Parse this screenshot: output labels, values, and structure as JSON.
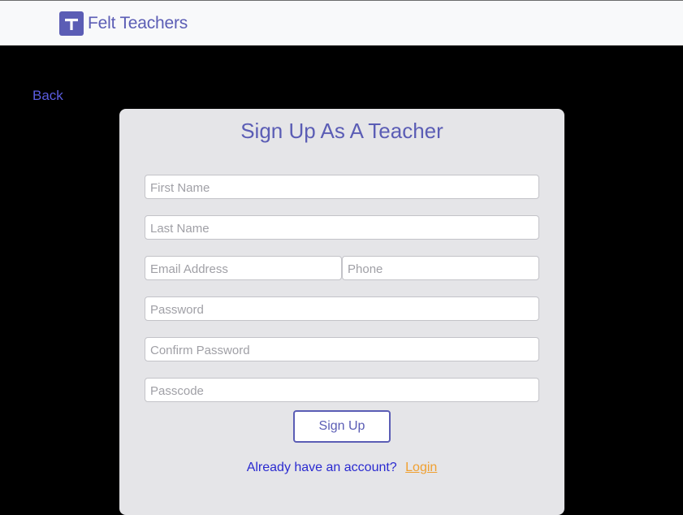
{
  "header": {
    "logo_letter": "T",
    "brand": "Felt Teachers",
    "colors": {
      "brand": "#5b5db5",
      "bar_bg": "#f8f9fa"
    }
  },
  "nav": {
    "back_label": "Back"
  },
  "form": {
    "title": "Sign Up As A Teacher",
    "fields": {
      "first_name": {
        "placeholder": "First Name",
        "value": ""
      },
      "last_name": {
        "placeholder": "Last Name",
        "value": ""
      },
      "email": {
        "placeholder": "Email Address",
        "value": ""
      },
      "phone": {
        "placeholder": "Phone",
        "value": ""
      },
      "password": {
        "placeholder": "Password",
        "value": ""
      },
      "confirm_password": {
        "placeholder": "Confirm Password",
        "value": ""
      },
      "passcode": {
        "placeholder": "Passcode",
        "value": ""
      }
    },
    "submit_label": "Sign Up",
    "login_prompt": "Already have an account?",
    "login_label": "Login",
    "colors": {
      "card_bg": "#e5e5e8",
      "accent": "#5b5db5",
      "link": "#f0a030",
      "prompt": "#2a2ad0"
    }
  }
}
